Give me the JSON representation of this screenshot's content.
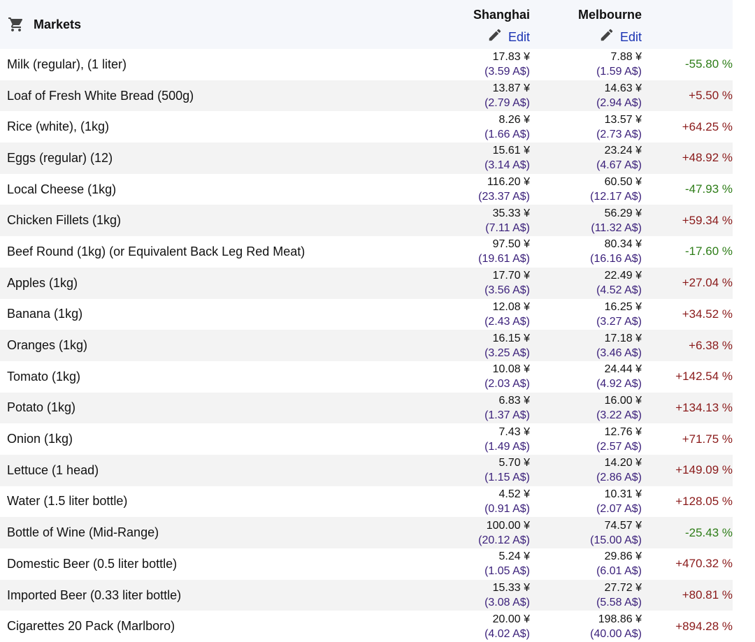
{
  "header": {
    "title": "Markets",
    "icon": "cart-icon",
    "cities": [
      {
        "name": "Shanghai",
        "edit_label": "Edit"
      },
      {
        "name": "Melbourne",
        "edit_label": "Edit"
      }
    ]
  },
  "colors": {
    "header_bg": "#f5f7fb",
    "row_alt_bg": "#f3f3f3",
    "link": "#1a33b3",
    "aud": "#3a1f7a",
    "positive": "#8a1a1a",
    "negative": "#2e7d18"
  },
  "rows": [
    {
      "item": "Milk (regular), (1 liter)",
      "shanghai_cny": "17.83 ¥",
      "shanghai_aud": "(3.59 A$)",
      "melbourne_cny": "7.88 ¥",
      "melbourne_aud": "(1.59 A$)",
      "diff": "-55.80 %"
    },
    {
      "item": "Loaf of Fresh White Bread (500g)",
      "shanghai_cny": "13.87 ¥",
      "shanghai_aud": "(2.79 A$)",
      "melbourne_cny": "14.63 ¥",
      "melbourne_aud": "(2.94 A$)",
      "diff": "+5.50 %"
    },
    {
      "item": "Rice (white), (1kg)",
      "shanghai_cny": "8.26 ¥",
      "shanghai_aud": "(1.66 A$)",
      "melbourne_cny": "13.57 ¥",
      "melbourne_aud": "(2.73 A$)",
      "diff": "+64.25 %"
    },
    {
      "item": "Eggs (regular) (12)",
      "shanghai_cny": "15.61 ¥",
      "shanghai_aud": "(3.14 A$)",
      "melbourne_cny": "23.24 ¥",
      "melbourne_aud": "(4.67 A$)",
      "diff": "+48.92 %"
    },
    {
      "item": "Local Cheese (1kg)",
      "shanghai_cny": "116.20 ¥",
      "shanghai_aud": "(23.37 A$)",
      "melbourne_cny": "60.50 ¥",
      "melbourne_aud": "(12.17 A$)",
      "diff": "-47.93 %"
    },
    {
      "item": "Chicken Fillets (1kg)",
      "shanghai_cny": "35.33 ¥",
      "shanghai_aud": "(7.11 A$)",
      "melbourne_cny": "56.29 ¥",
      "melbourne_aud": "(11.32 A$)",
      "diff": "+59.34 %"
    },
    {
      "item": "Beef Round (1kg) (or Equivalent Back Leg Red Meat)",
      "shanghai_cny": "97.50 ¥",
      "shanghai_aud": "(19.61 A$)",
      "melbourne_cny": "80.34 ¥",
      "melbourne_aud": "(16.16 A$)",
      "diff": "-17.60 %"
    },
    {
      "item": "Apples (1kg)",
      "shanghai_cny": "17.70 ¥",
      "shanghai_aud": "(3.56 A$)",
      "melbourne_cny": "22.49 ¥",
      "melbourne_aud": "(4.52 A$)",
      "diff": "+27.04 %"
    },
    {
      "item": "Banana (1kg)",
      "shanghai_cny": "12.08 ¥",
      "shanghai_aud": "(2.43 A$)",
      "melbourne_cny": "16.25 ¥",
      "melbourne_aud": "(3.27 A$)",
      "diff": "+34.52 %"
    },
    {
      "item": "Oranges (1kg)",
      "shanghai_cny": "16.15 ¥",
      "shanghai_aud": "(3.25 A$)",
      "melbourne_cny": "17.18 ¥",
      "melbourne_aud": "(3.46 A$)",
      "diff": "+6.38 %"
    },
    {
      "item": "Tomato (1kg)",
      "shanghai_cny": "10.08 ¥",
      "shanghai_aud": "(2.03 A$)",
      "melbourne_cny": "24.44 ¥",
      "melbourne_aud": "(4.92 A$)",
      "diff": "+142.54 %"
    },
    {
      "item": "Potato (1kg)",
      "shanghai_cny": "6.83 ¥",
      "shanghai_aud": "(1.37 A$)",
      "melbourne_cny": "16.00 ¥",
      "melbourne_aud": "(3.22 A$)",
      "diff": "+134.13 %"
    },
    {
      "item": "Onion (1kg)",
      "shanghai_cny": "7.43 ¥",
      "shanghai_aud": "(1.49 A$)",
      "melbourne_cny": "12.76 ¥",
      "melbourne_aud": "(2.57 A$)",
      "diff": "+71.75 %"
    },
    {
      "item": "Lettuce (1 head)",
      "shanghai_cny": "5.70 ¥",
      "shanghai_aud": "(1.15 A$)",
      "melbourne_cny": "14.20 ¥",
      "melbourne_aud": "(2.86 A$)",
      "diff": "+149.09 %"
    },
    {
      "item": "Water (1.5 liter bottle)",
      "shanghai_cny": "4.52 ¥",
      "shanghai_aud": "(0.91 A$)",
      "melbourne_cny": "10.31 ¥",
      "melbourne_aud": "(2.07 A$)",
      "diff": "+128.05 %"
    },
    {
      "item": "Bottle of Wine (Mid-Range)",
      "shanghai_cny": "100.00 ¥",
      "shanghai_aud": "(20.12 A$)",
      "melbourne_cny": "74.57 ¥",
      "melbourne_aud": "(15.00 A$)",
      "diff": "-25.43 %"
    },
    {
      "item": "Domestic Beer (0.5 liter bottle)",
      "shanghai_cny": "5.24 ¥",
      "shanghai_aud": "(1.05 A$)",
      "melbourne_cny": "29.86 ¥",
      "melbourne_aud": "(6.01 A$)",
      "diff": "+470.32 %"
    },
    {
      "item": "Imported Beer (0.33 liter bottle)",
      "shanghai_cny": "15.33 ¥",
      "shanghai_aud": "(3.08 A$)",
      "melbourne_cny": "27.72 ¥",
      "melbourne_aud": "(5.58 A$)",
      "diff": "+80.81 %"
    },
    {
      "item": "Cigarettes 20 Pack (Marlboro)",
      "shanghai_cny": "20.00 ¥",
      "shanghai_aud": "(4.02 A$)",
      "melbourne_cny": "198.86 ¥",
      "melbourne_aud": "(40.00 A$)",
      "diff": "+894.28 %"
    }
  ]
}
